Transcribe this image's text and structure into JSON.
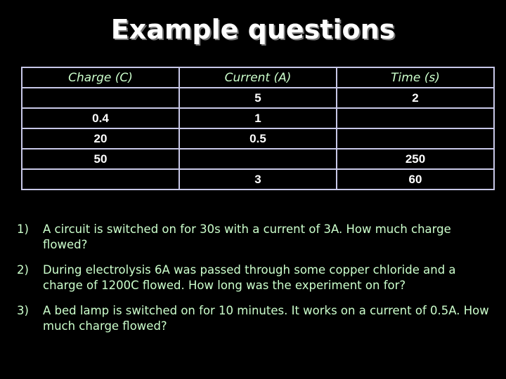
{
  "title": "Example questions",
  "table": {
    "headers": [
      "Charge (C)",
      "Current (A)",
      "Time (s)"
    ],
    "rows": [
      [
        "",
        "5",
        "2"
      ],
      [
        "0.4",
        "1",
        ""
      ],
      [
        "20",
        "0.5",
        ""
      ],
      [
        "50",
        "",
        "250"
      ],
      [
        "",
        "3",
        "60"
      ]
    ]
  },
  "questions": [
    {
      "number": "1)",
      "text": "A circuit is switched on for 30s with a current of 3A.  How much charge flowed?"
    },
    {
      "number": "2)",
      "text": "During electrolysis 6A was passed through some copper chloride and a charge of 1200C flowed.  How long was the experiment on for?"
    },
    {
      "number": "3)",
      "text": "A bed lamp is switched on for 10 minutes.  It works on a current of 0.5A.  How much charge flowed?"
    }
  ],
  "colors": {
    "background": "#000000",
    "title": "#ffffff",
    "header_text": "#ccffcc",
    "cell_text": "#ffffff",
    "table_border": "#c8c8e8",
    "question_text": "#ccffcc"
  }
}
